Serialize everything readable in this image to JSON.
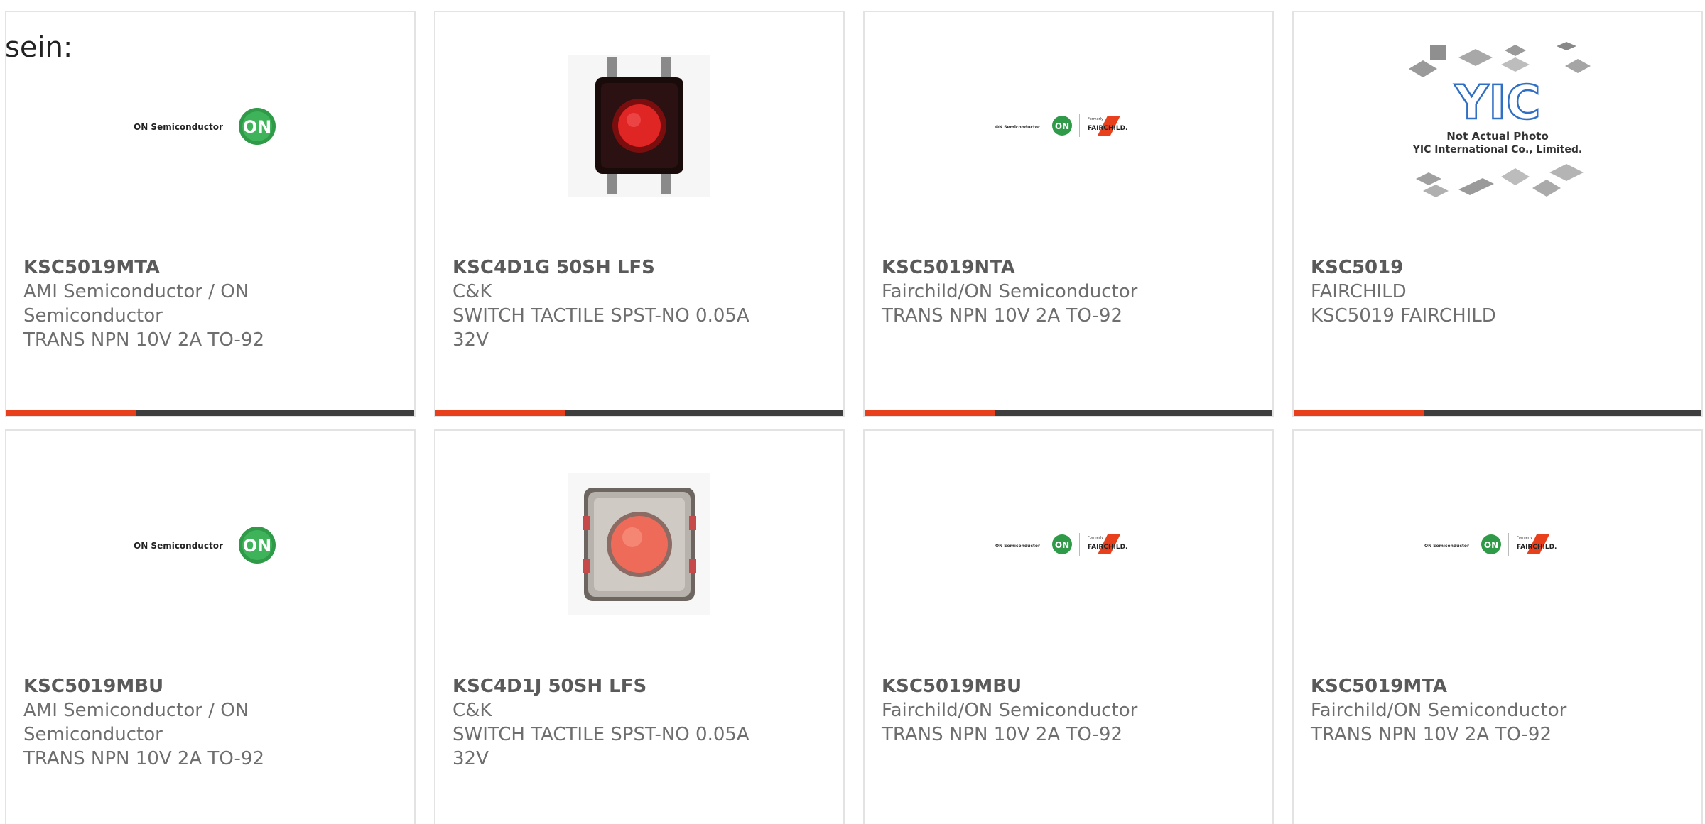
{
  "heading": "sein:",
  "colors": {
    "accent_bar": "#e8401c",
    "bar_dark": "#3e3e3e",
    "card_border": "#e3e3e3",
    "text_muted": "#6e6e6e"
  },
  "products": [
    {
      "image": "on-semiconductor-logo",
      "logo_text": "ON Semiconductor",
      "logo_mark": "ON",
      "part_number": "KSC5019MTA",
      "manufacturer": "AMI Semiconductor / ON Semiconductor",
      "description": "TRANS NPN 10V 2A TO-92"
    },
    {
      "image": "tactile-switch-photo",
      "part_number": "KSC4D1G 50SH LFS",
      "manufacturer": "C&K",
      "description": "SWITCH TACTILE SPST-NO 0.05A 32V"
    },
    {
      "image": "on-fairchild-logo",
      "logo_text": "ON Semiconductor",
      "logo_mark": "ON",
      "formerly_text": "Formerly",
      "fairchild_text": "FAIRCHILD.",
      "part_number": "KSC5019NTA",
      "manufacturer": "Fairchild/ON Semiconductor",
      "description": "TRANS NPN 10V 2A TO-92"
    },
    {
      "image": "yic-placeholder",
      "yic_logo": "YIC",
      "yic_line1": "Not Actual Photo",
      "yic_line2": "YIC International Co., Limited.",
      "part_number": "KSC5019",
      "manufacturer": "FAIRCHILD",
      "description": "KSC5019 FAIRCHILD"
    },
    {
      "image": "on-semiconductor-logo",
      "logo_text": "ON Semiconductor",
      "logo_mark": "ON",
      "part_number": "KSC5019MBU",
      "manufacturer": "AMI Semiconductor / ON Semiconductor",
      "description": "TRANS NPN 10V 2A TO-92"
    },
    {
      "image": "tactile-switch-photo-silver",
      "part_number": "KSC4D1J 50SH LFS",
      "manufacturer": "C&K",
      "description": "SWITCH TACTILE SPST-NO 0.05A 32V"
    },
    {
      "image": "on-fairchild-logo",
      "logo_text": "ON Semiconductor",
      "logo_mark": "ON",
      "formerly_text": "Formerly",
      "fairchild_text": "FAIRCHILD.",
      "part_number": "KSC5019MBU",
      "manufacturer": "Fairchild/ON Semiconductor",
      "description": "TRANS NPN 10V 2A TO-92"
    },
    {
      "image": "on-fairchild-logo",
      "logo_text": "ON Semiconductor",
      "logo_mark": "ON",
      "formerly_text": "Formerly",
      "fairchild_text": "FAIRCHILD.",
      "part_number": "KSC5019MTA",
      "manufacturer": "Fairchild/ON Semiconductor",
      "description": "TRANS NPN 10V 2A TO-92"
    }
  ]
}
